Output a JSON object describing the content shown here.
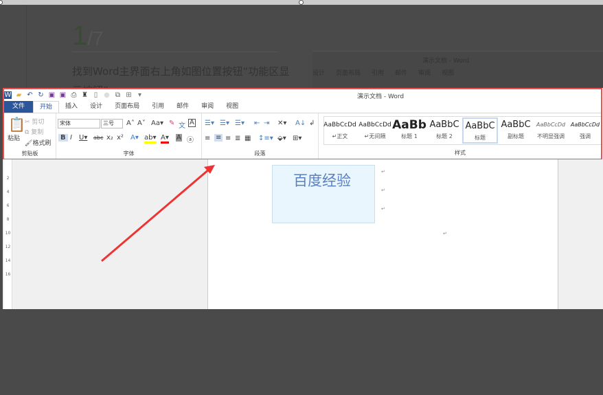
{
  "step": {
    "current": "1",
    "total": "/7"
  },
  "instruction": "找到Word主界面右上角如图位置按钮“功能区显示按钮”",
  "bg_preview": {
    "title": "演示文档 - Word",
    "tabs": [
      "设计",
      "页面布局",
      "引用",
      "邮件",
      "审阅",
      "视图"
    ]
  },
  "word": {
    "title": "演示文档 - Word",
    "tabs": [
      "文件",
      "开始",
      "插入",
      "设计",
      "页面布局",
      "引用",
      "邮件",
      "审阅",
      "视图"
    ],
    "clipboard": {
      "label": "剪贴板",
      "paste": "粘贴",
      "cut": "剪切",
      "copy": "复制",
      "format_painter": "格式刷"
    },
    "font": {
      "label": "字体",
      "name": "宋体",
      "size": "三号"
    },
    "paragraph": {
      "label": "段落"
    },
    "styles": {
      "label": "样式",
      "items": [
        {
          "preview": "AaBbCcDd",
          "name": "↵正文"
        },
        {
          "preview": "AaBbCcDd",
          "name": "↵无间隔"
        },
        {
          "preview": "AaBb",
          "name": "标题 1"
        },
        {
          "preview": "AaBbC",
          "name": "标题 2"
        },
        {
          "preview": "AaBbC",
          "name": "标题"
        },
        {
          "preview": "AaBbC",
          "name": "副标题"
        },
        {
          "preview": "AaBbCcDd",
          "name": "不明显强调"
        },
        {
          "preview": "AaBbCcDd",
          "name": "强调"
        }
      ]
    },
    "document": {
      "wordart": "百度经验",
      "ruler": [
        "2",
        "4",
        "6",
        "8",
        "10",
        "12",
        "14",
        "16"
      ]
    }
  },
  "colors": {
    "accent": "#2b579a",
    "highlight_box": "#f05050",
    "arrow": "#ee3333",
    "overlay": "#4a4a4a"
  }
}
